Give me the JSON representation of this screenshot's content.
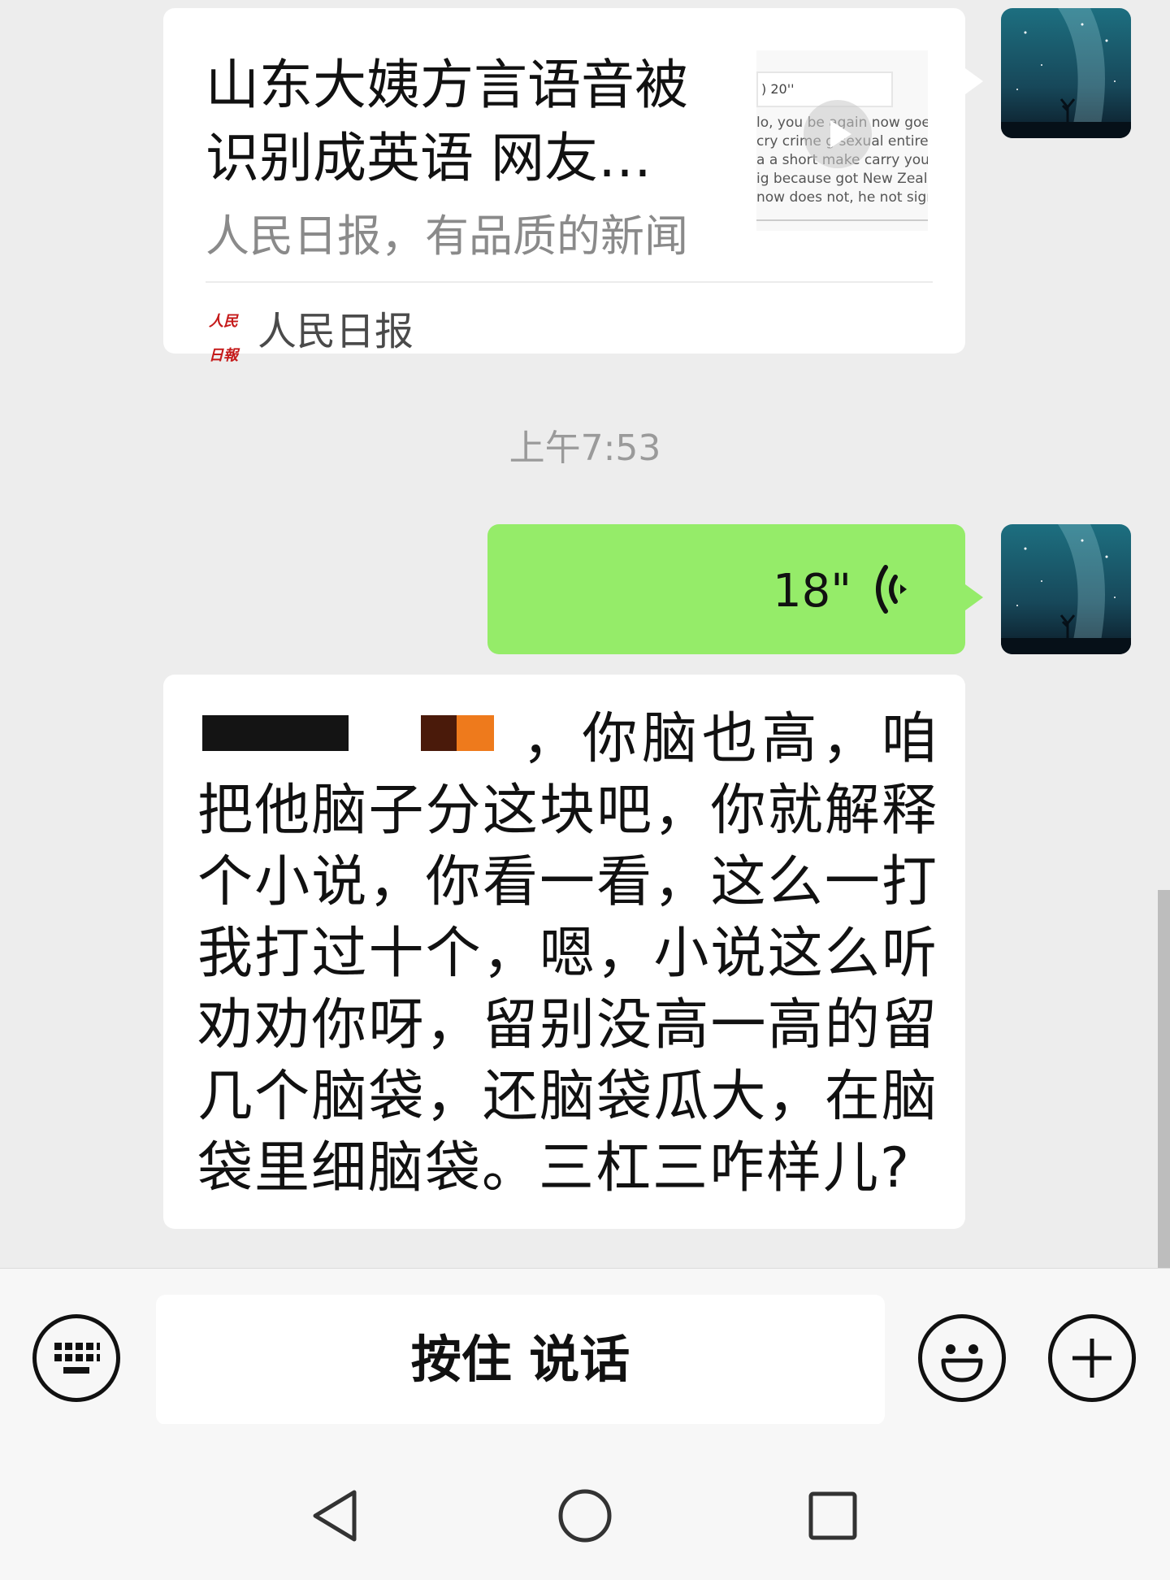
{
  "article": {
    "title": "山东大姨方言语音被识别成英语 网友…",
    "description": "人民日报，有品质的新闻",
    "source_name": "人民日报",
    "source_logo_text": "人民日報",
    "thumbnail": {
      "duration_label": ") 20''",
      "lines": [
        "lo, you be again now goes",
        "cry crime g sexual entire ti",
        "a a short make carry young",
        "ig because got New Zealan",
        "now does not, he not sign?"
      ]
    }
  },
  "timestamp": "上午7:53",
  "voice_message": {
    "duration": "18\"",
    "icon": "voice-wave-icon"
  },
  "text_message": {
    "line1_tail": "，你脑也高，咱把",
    "body": "他脑子分这块吧，你就解释个小说，你看一看，这么一打我打过十个，嗯，小说这么听劝劝你呀，留别没高一高的留几个脑袋，还脑袋瓜大，在脑袋里细脑袋。三杠三咋样儿?"
  },
  "input_bar": {
    "hold_to_talk_label": "按住 说话",
    "left_icon": "keyboard-icon",
    "emoji_icon": "emoji-icon",
    "plus_icon": "plus-icon"
  },
  "nav_bar": {
    "back_icon": "back-triangle-icon",
    "home_icon": "home-circle-icon",
    "recents_icon": "recents-square-icon"
  },
  "colors": {
    "background": "#ededed",
    "self_bubble": "#95ec69",
    "other_bubble": "#ffffff",
    "redaction_dark": "#141414",
    "redaction_brown": "#4a1a0a",
    "redaction_orange": "#ee7a1c"
  }
}
